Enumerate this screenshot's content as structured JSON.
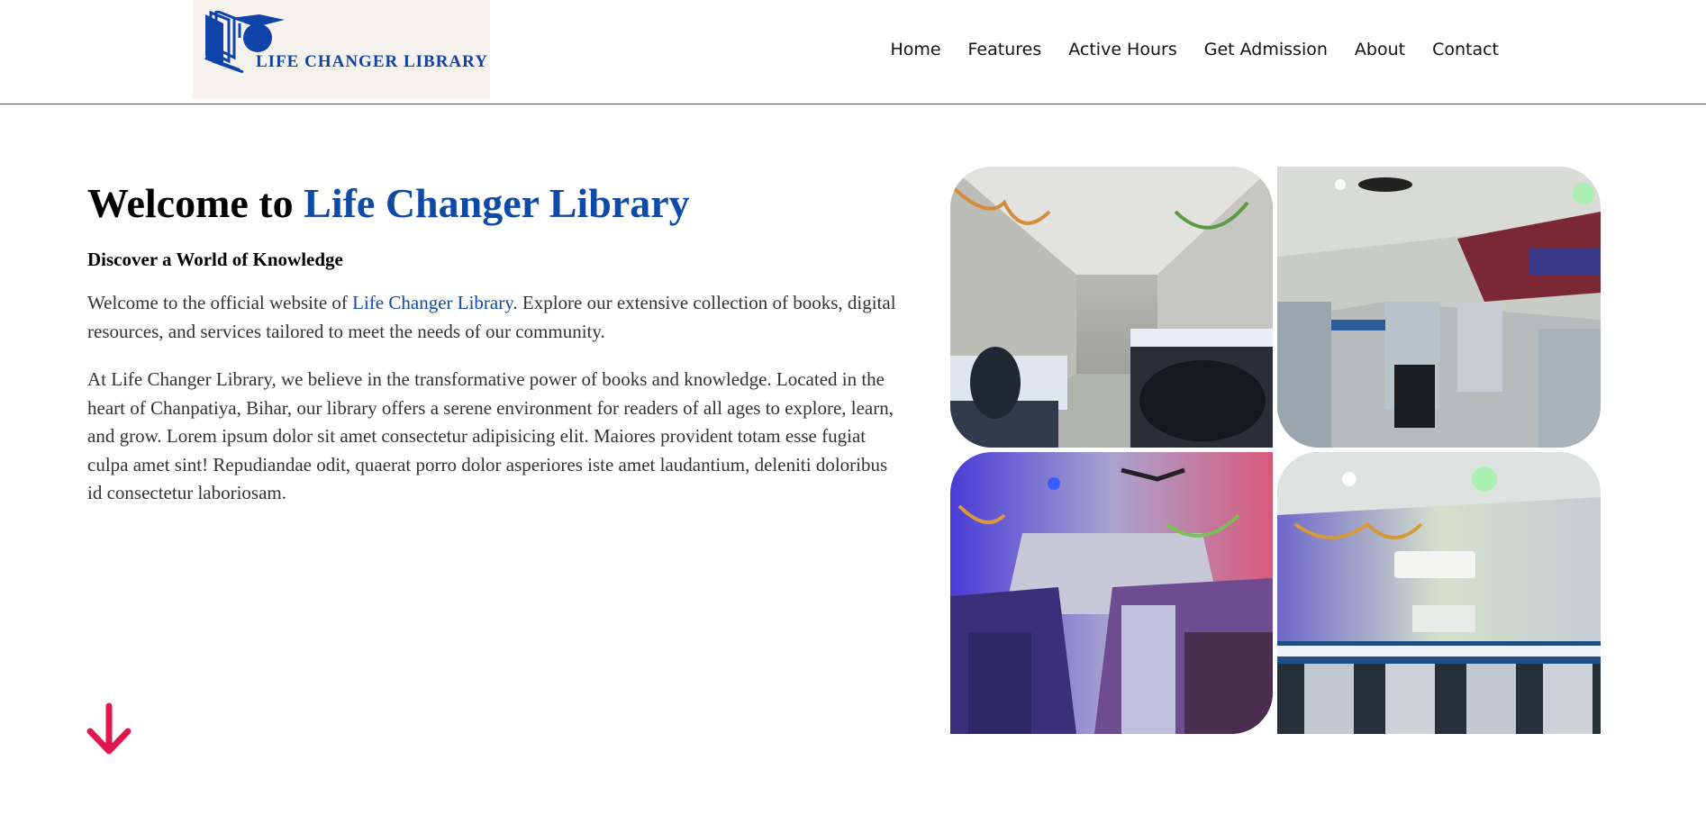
{
  "header": {
    "logo_text": "LIFE CHANGER LIBRARY",
    "nav": [
      {
        "label": "Home"
      },
      {
        "label": "Features"
      },
      {
        "label": "Active Hours"
      },
      {
        "label": "Get Admission"
      },
      {
        "label": "About"
      },
      {
        "label": "Contact"
      }
    ]
  },
  "hero": {
    "title_prefix": "Welcome to ",
    "title_accent": "Life Changer Library",
    "subtitle": "Discover a World of Knowledge",
    "para1_prefix": "Welcome to the official website of ",
    "para1_link": "Life Changer Library",
    "para1_suffix": ". Explore our extensive collection of books, digital resources, and services tailored to meet the needs of our community.",
    "para2": "At Life Changer Library, we believe in the transformative power of books and knowledge. Located in the heart of Chanpatiya, Bihar, our library offers a serene environment for readers of all ages to explore, learn, and grow. Lorem ipsum dolor sit amet consectetur adipisicing elit. Maiores provident totam esse fugiat culpa amet sint! Repudiandae odit, quaerat porro dolor asperiores iste amet laudantium, deleniti doloribus id consectetur laboriosam."
  },
  "colors": {
    "brand_blue": "#0f4aa8",
    "arrow_red": "#e0174f",
    "logo_bg": "#f6f3ef"
  },
  "icons": {
    "scroll": "arrow-down-icon",
    "logo": "book-graduation-cap-icon"
  }
}
